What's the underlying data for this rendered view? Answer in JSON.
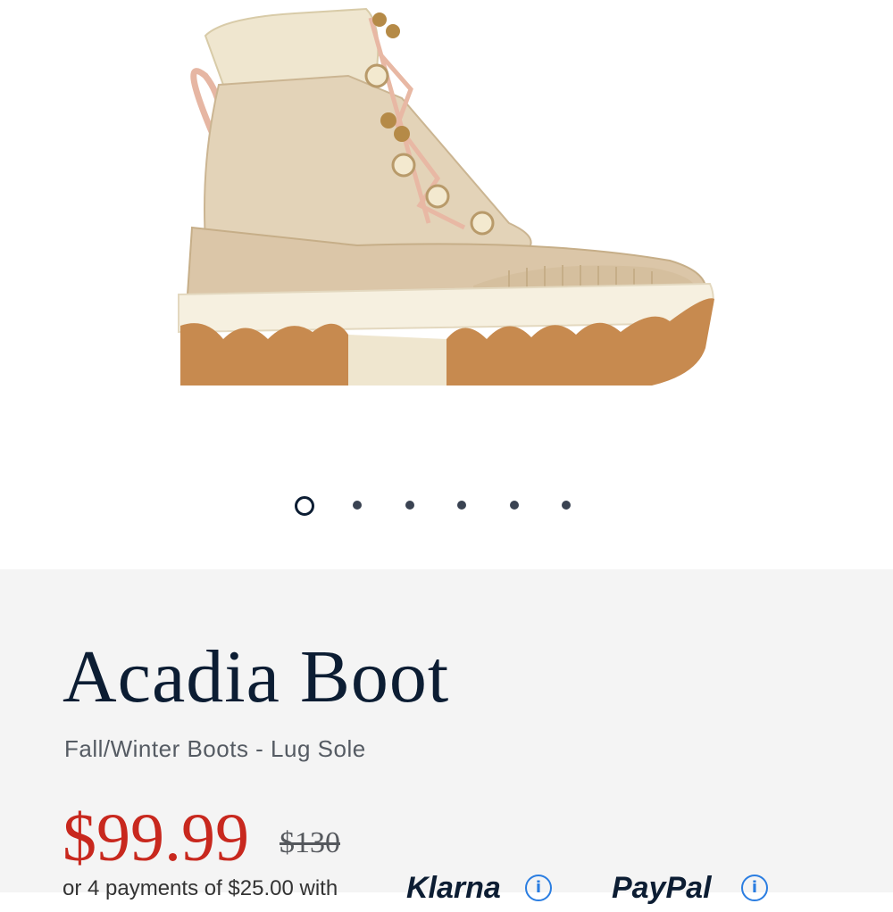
{
  "product": {
    "name": "Acadia Boot",
    "category": "Fall/Winter Boots - Lug Sole",
    "sale_price": "$99.99",
    "original_price": "$130"
  },
  "gallery": {
    "image_alt": "Acadia Boot",
    "slide_count": 6,
    "active_slide": 1
  },
  "installments": {
    "text": "or 4 payments of $25.00 with",
    "klarna_label": "Klarna",
    "paypal_label": "PayPal",
    "info_glyph": "i"
  },
  "colors": {
    "title": "#0c1d33",
    "price": "#c8281e",
    "info_accent": "#2a7de1",
    "panel_background": "#f4f4f4"
  }
}
